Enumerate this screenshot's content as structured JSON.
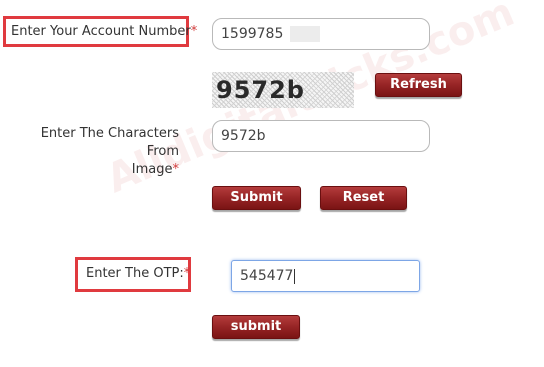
{
  "account": {
    "label": "Enter Your Account Number",
    "required_mark": "*",
    "value": "1599785"
  },
  "captcha": {
    "image_text": "9572b",
    "refresh_label": "Refresh",
    "label_line1": "Enter The Characters From",
    "label_line2": "Image",
    "required_mark": "*",
    "input_value": "9572b"
  },
  "form_actions": {
    "submit_label": "Submit",
    "reset_label": "Reset"
  },
  "otp": {
    "label": "Enter The OTP:",
    "required_mark": "*",
    "value": "545477",
    "submit_label": "submit"
  },
  "watermark": "Alldigitaltricks.com",
  "colors": {
    "highlight": "#e03a3f",
    "button": "#962425",
    "required": "#d23a3a"
  }
}
